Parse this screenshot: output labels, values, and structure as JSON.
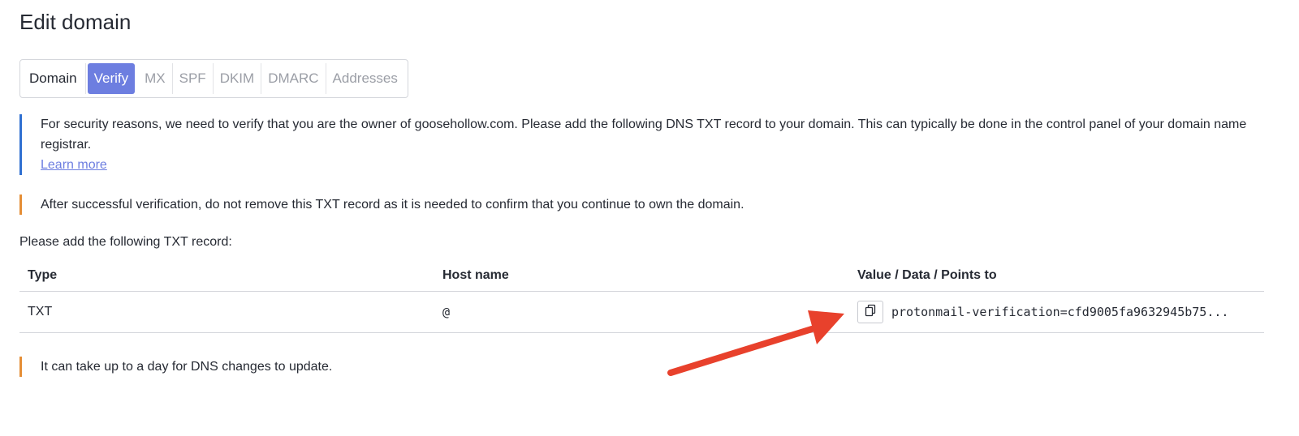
{
  "page": {
    "title": "Edit domain"
  },
  "tabs": [
    {
      "label": "Domain",
      "state": "default"
    },
    {
      "label": "Verify",
      "state": "active"
    },
    {
      "label": "MX",
      "state": "disabled"
    },
    {
      "label": "SPF",
      "state": "disabled"
    },
    {
      "label": "DKIM",
      "state": "disabled"
    },
    {
      "label": "DMARC",
      "state": "disabled"
    },
    {
      "label": "Addresses",
      "state": "disabled"
    }
  ],
  "notices": {
    "security": "For security reasons, we need to verify that you are the owner of goosehollow.com. Please add the following DNS TXT record to your domain. This can typically be done in the control panel of your domain name registrar.",
    "learn_more": "Learn more",
    "after_verification": "After successful verification, do not remove this TXT record as it is needed to confirm that you continue to own the domain.",
    "dns_delay": "It can take up to a day for DNS changes to update."
  },
  "record_intro": "Please add the following TXT record:",
  "table": {
    "headers": {
      "type": "Type",
      "host": "Host name",
      "value": "Value / Data / Points to"
    },
    "rows": [
      {
        "type": "TXT",
        "host": "@",
        "value": "protonmail-verification=cfd9005fa9632945b75..."
      }
    ]
  },
  "icons": {
    "copy": "copy-icon",
    "annotation": "red-arrow-annotation"
  },
  "colors": {
    "accent": "#6d7ee0",
    "info_border": "#2f6fd1",
    "warning_border": "#e58e36",
    "annotation": "#e8412c"
  }
}
